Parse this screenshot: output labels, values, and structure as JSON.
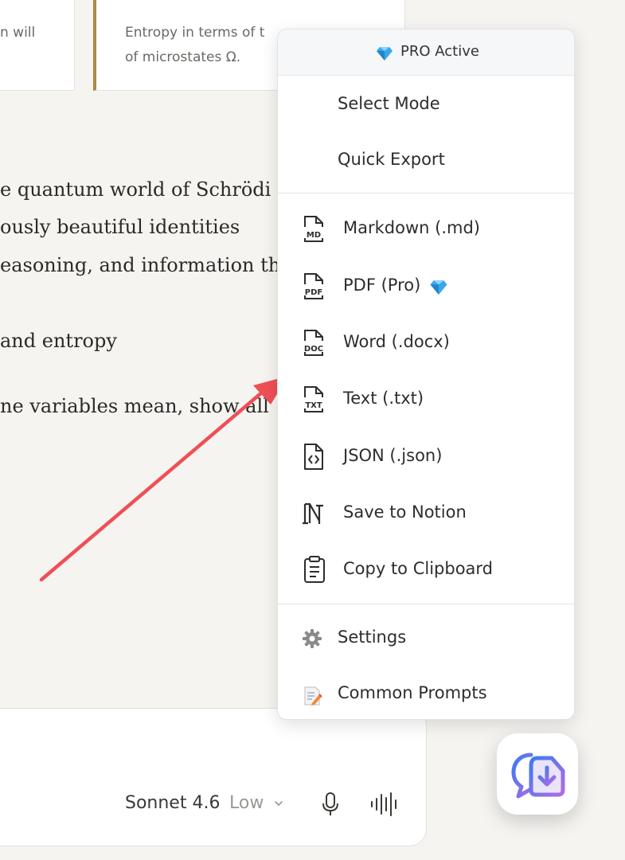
{
  "cards": {
    "left_text": "n will",
    "right_line1": "Entropy in terms of t",
    "right_line2": "of microstates Ω."
  },
  "paragraphs": [
    "e quantum world of Schrödi",
    "ously beautiful identities",
    "easoning, and information th",
    " and entropy",
    "ne variables mean, show all"
  ],
  "composer": {
    "model": "Sonnet 4.6",
    "effort": "Low"
  },
  "menu": {
    "header": "PRO Active",
    "modes": [
      "Select Mode",
      "Quick Export"
    ],
    "exports": [
      {
        "label": "Markdown (.md)",
        "icon": "md-file-icon",
        "tag": "MD"
      },
      {
        "label": "PDF (Pro)",
        "icon": "pdf-file-icon",
        "tag": "PDF"
      },
      {
        "label": "Word (.docx)",
        "icon": "docx-file-icon",
        "tag": "DOC"
      },
      {
        "label": "Text (.txt)",
        "icon": "txt-file-icon",
        "tag": "TXT"
      },
      {
        "label": "JSON (.json)",
        "icon": "json-file-icon"
      },
      {
        "label": "Save to Notion",
        "icon": "notion-icon"
      },
      {
        "label": "Copy to Clipboard",
        "icon": "clipboard-icon"
      }
    ],
    "footer": [
      {
        "label": "Settings",
        "icon": "gear-icon"
      },
      {
        "label": "Common Prompts",
        "icon": "memo-icon"
      }
    ]
  },
  "colors": {
    "card_accent": "#b08845",
    "arrow": "#ef4f56",
    "gem": "#3aa7e8",
    "fab_gradient_start": "#3b7bf0",
    "fab_gradient_end": "#b06be6"
  }
}
